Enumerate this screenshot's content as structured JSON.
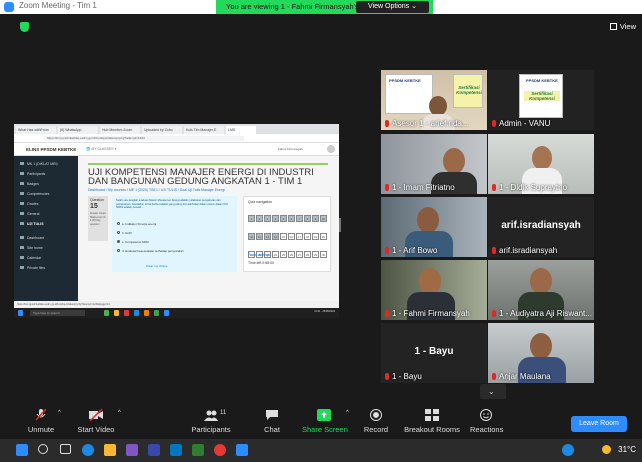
{
  "window": {
    "title": "Zoom Meeting - Tim 1",
    "banner": "You are viewing 1 - Fahmi Firmansyah's screen",
    "view_options": "View Options ⌄",
    "view_label": "View"
  },
  "shared": {
    "tabs": [
      "What Has withFrom",
      "(6) WhatsApp",
      "Hub Member-Zoom",
      "Uploaded by Zoho",
      "Kuis Tim Manajer E",
      "LMS"
    ],
    "url": "https://lms.ppsdmkebtke.esdm.go.id/mod/quiz/attempt.php?attempt=1234",
    "brand": "ELINS PPSDM KEBTKE",
    "lang": "🌐 MY CLASSES ▾",
    "user": "Fahmi Firmansyah",
    "nav": [
      "MK 1 (DIKLAT MEI)",
      "Participants",
      "Badges",
      "Competencies",
      "Grades",
      "General",
      "UJI TULIS",
      "Dashboard",
      "Site home",
      "Calendar",
      "Private files"
    ],
    "heading": "UJI KOMPETENSI MANAJER ENERGI DI INDUSTRI DAN BANGUNAN GEDUNG ANGKATAN 1 - TIM 1",
    "crumb": "Dashboard / My courses / ME 1 (2020) TIM 1 / UJI TULIS / Soal Uji Tulis Manajer Energi",
    "question_label": "Question",
    "question_no": "15",
    "question_status": "Answer saved Marked out of 1.00 Flag question",
    "question_text": "Salah satu langkah evaluasi Sistem Manajemen Energi adalah melakukan pengukuran dan pemantauan. Kesalahan di hal berikut adalah yang paling dimutakhirkan dalam sistem dalam ISO 50001 adalah, kecuali ...",
    "options": [
      "a. Indikator Kinerja energi",
      "b. EnPI",
      "c. Kompetensi SDM",
      "d. Evaluasi kesesuaiaan terhadap persyaratan"
    ],
    "clear": "Clear my choice",
    "qnav_title": "Quiz navigation",
    "cells": [
      "1",
      "2",
      "3",
      "4",
      "5",
      "6",
      "7",
      "8",
      "9",
      "10",
      "11",
      "12",
      "13",
      "14",
      "15",
      "16",
      "17",
      "18",
      "19",
      "20",
      "21",
      "22",
      "23",
      "24",
      "25",
      "26",
      "27",
      "28",
      "29",
      "30"
    ],
    "finish": "Finish attempt ...",
    "time_left": "Time left 0:58:00",
    "status_url": "https://lms.ppsdmkebtke.esdm.go.id/mod/quiz/attempt.php?attempt=1234&page=14",
    "search": "Type here to search",
    "clock": "11:41 · 25/05/2022"
  },
  "tiles": [
    {
      "name": "Asesor 1 - arief.rida...",
      "muted": true
    },
    {
      "name": "Admin - VANU",
      "muted": true
    },
    {
      "name": "1 - Imam Fitriatno",
      "muted": true
    },
    {
      "name": "1 - Didik Supraytno",
      "muted": true
    },
    {
      "name": "1 - Arif Bowo",
      "muted": true
    },
    {
      "name": "arif.isradiansyah",
      "big": "arif.isradiansyah",
      "muted": true
    },
    {
      "name": "1 - Fahmi Firmansyah",
      "muted": true
    },
    {
      "name": "1 - Audiyatra Aji Riswant...",
      "muted": true
    },
    {
      "name": "1 - Bayu",
      "big": "1 - Bayu",
      "muted": true
    },
    {
      "name": "Anjar Maulana",
      "muted": true
    }
  ],
  "posters": {
    "brand": "PPSDM KEBTKE",
    "slogan": "Sertifikasi Kompetensi"
  },
  "toolbar": {
    "unmute": "Unmute",
    "video": "Start Video",
    "participants": "Participants",
    "participants_count": "11",
    "chat": "Chat",
    "share": "Share Screen",
    "record": "Record",
    "breakout": "Breakout Rooms",
    "reactions": "Reactions",
    "leave": "Leave Room"
  },
  "taskbar": {
    "temp": "31°C"
  },
  "colors": {
    "share_green": "#23d959",
    "leave_blue": "#2d8cff",
    "active_outline": "#c8e629",
    "muted_red": "#e02828"
  }
}
